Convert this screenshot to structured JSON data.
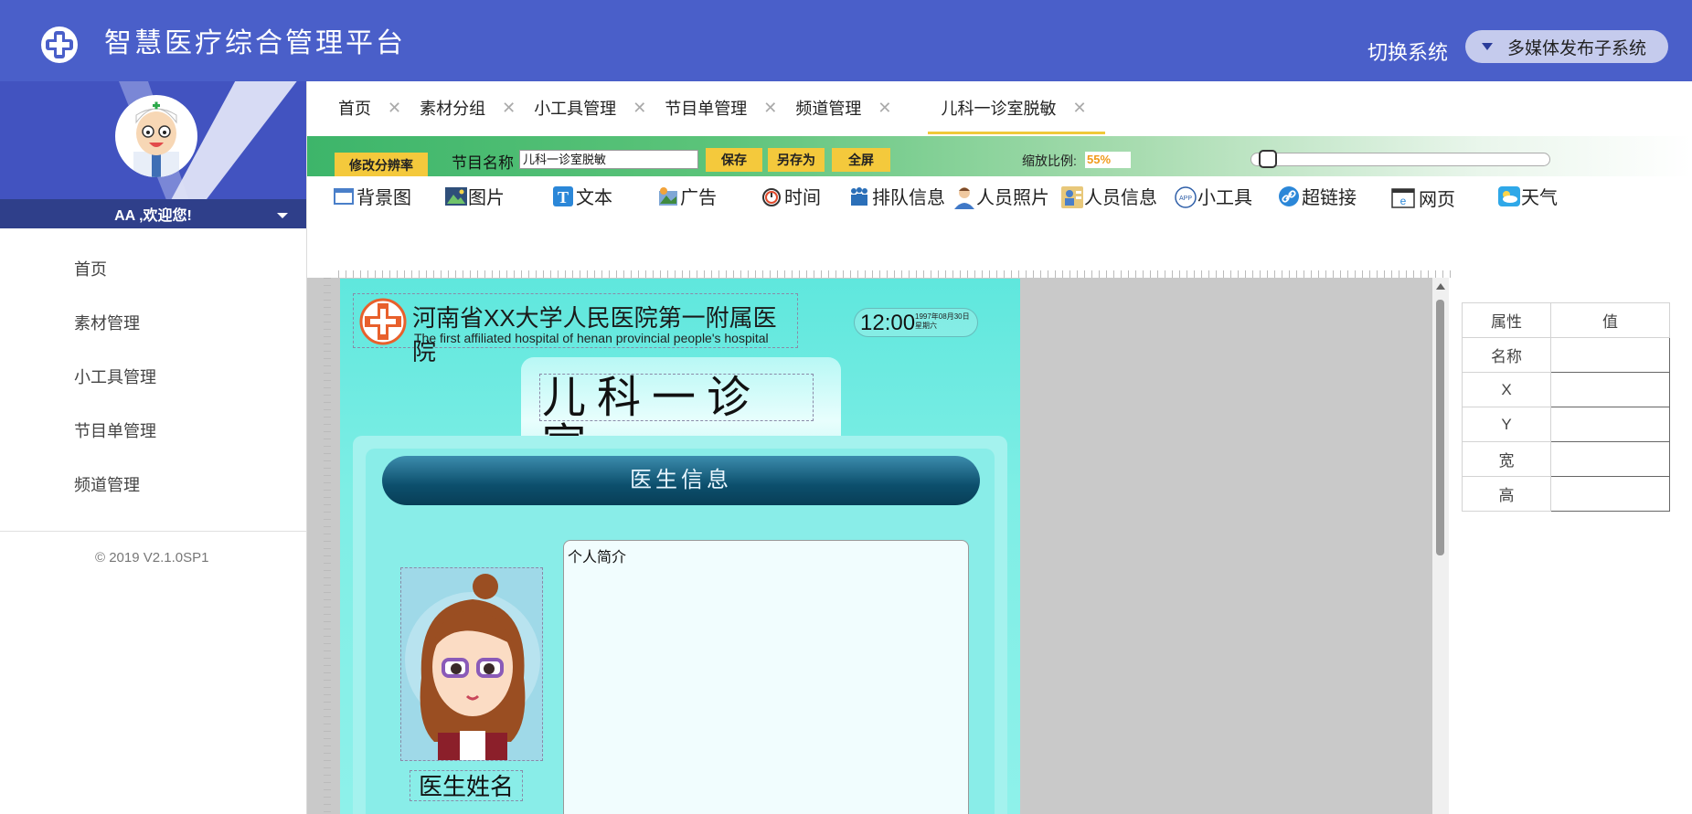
{
  "header": {
    "app_title": "智慧医疗综合管理平台",
    "switch_label": "切换系统",
    "switch_value": "多媒体发布子系统"
  },
  "sidebar": {
    "welcome": "AA ,欢迎您!",
    "items": [
      {
        "label": "首页"
      },
      {
        "label": "素材管理"
      },
      {
        "label": "小工具管理"
      },
      {
        "label": "节目单管理"
      },
      {
        "label": "频道管理"
      }
    ],
    "copyright": "© 2019 V2.1.0SP1"
  },
  "tabs": [
    {
      "label": "首页",
      "active": false
    },
    {
      "label": "素材分组",
      "active": false
    },
    {
      "label": "小工具管理",
      "active": false
    },
    {
      "label": "节目单管理",
      "active": false
    },
    {
      "label": "频道管理",
      "active": false
    },
    {
      "label": "儿科一诊室脱敏",
      "active": true
    }
  ],
  "toolbar": {
    "resolution_button": "修改分辨率",
    "program_name_label": "节目名称",
    "program_name_value": "儿科一诊室脱敏",
    "save": "保存",
    "save_as": "另存为",
    "fullscreen": "全屏",
    "zoom_label": "缩放比例:",
    "zoom_value": "55%",
    "zoom_slider_fraction": 0.03
  },
  "widgets": [
    {
      "label": "背景图",
      "icon": "background-icon"
    },
    {
      "label": "图片",
      "icon": "image-icon"
    },
    {
      "label": "文本",
      "icon": "text-icon"
    },
    {
      "label": "广告",
      "icon": "ad-icon"
    },
    {
      "label": "时间",
      "icon": "clock-icon"
    },
    {
      "label": "排队信息",
      "icon": "queue-icon"
    },
    {
      "label": "人员照片",
      "icon": "person-photo-icon"
    },
    {
      "label": "人员信息",
      "icon": "person-info-icon"
    },
    {
      "label": "小工具",
      "icon": "app-icon"
    },
    {
      "label": "超链接",
      "icon": "link-icon"
    },
    {
      "label": "网页",
      "icon": "webpage-icon"
    },
    {
      "label": "天气",
      "icon": "weather-icon"
    }
  ],
  "canvas": {
    "hospital_name": "河南省XX大学人民医院第一附属医院",
    "hospital_en": "The first affiliated hospital of henan provincial people's hospital",
    "time": "12:00",
    "date": "1997年08月30日",
    "weekday": "星期六",
    "room_title": "儿科一诊室",
    "doctor_info_header": "医生信息",
    "doctor_name": "医生姓名",
    "intro_title": "个人简介",
    "colors": {
      "stage": "#7eeee5",
      "banner": "#0c4f6c"
    }
  },
  "properties": {
    "header_attr": "属性",
    "header_val": "值",
    "rows": [
      {
        "label": "名称",
        "value": ""
      },
      {
        "label": "X",
        "value": ""
      },
      {
        "label": "Y",
        "value": ""
      },
      {
        "label": "宽",
        "value": ""
      },
      {
        "label": "高",
        "value": ""
      }
    ]
  },
  "colors": {
    "header_bg": "#4a5fc9",
    "accent_yellow": "#f4c93c",
    "toolbar_green": "#3db56a"
  }
}
